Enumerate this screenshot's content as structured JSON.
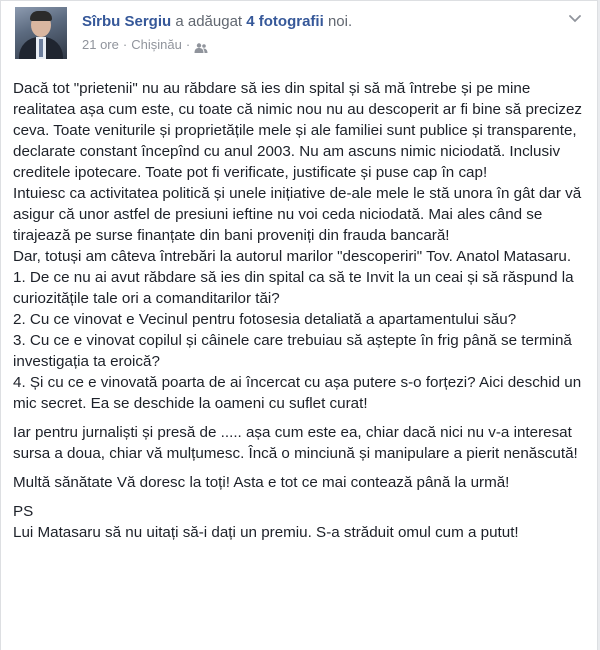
{
  "post": {
    "author": "Sîrbu Sergiu",
    "action_prefix": "a adăugat",
    "action_link": "4 fotografii",
    "action_suffix": "noi.",
    "time": "21 ore",
    "separator": "·",
    "location": "Chișinău",
    "audience_icon": "friends-icon",
    "menu_icon": "chevron-down-icon",
    "paragraphs": [
      "Dacă tot \"prietenii\" nu au răbdare să ies din spital și să mă întrebe și pe mine realitatea așa cum este, cu toate că nimic nou nu au descoperit ar fi bine să precizez ceva. Toate veniturile și proprietățile mele și ale familiei sunt publice și transparente, declarate constant începînd cu anul 2003. Nu am ascuns nimic niciodată. Inclusiv creditele ipotecare. Toate pot fi verificate, justificate și puse cap în cap!",
      "Intuiesc ca activitatea politică și unele inițiative de-ale mele le stă unora în gât dar vă asigur că unor astfel de presiuni ieftine nu voi ceda niciodată. Mai ales când se tirajează pe surse finanțate din bani proveniți din frauda bancară!",
      "Dar, totuși am câteva întrebări la autorul marilor \"descoperiri\" Tov. Anatol Matasaru.",
      "1. De ce nu ai avut răbdare să ies din spital ca să te Invit la un ceai și să răspund la curiozitățile tale ori a comanditarilor tăi?",
      "2. Cu ce vinovat e Vecinul pentru fotosesia detaliată a apartamentului său?",
      "3. Cu ce e vinovat copilul și câinele care trebuiau să aștepte în frig până se termină investigația ta eroică?",
      "4. Și cu ce e vinovată poarta de ai încercat cu așa putere s-o forțezi? Aici deschid un mic secret. Ea se deschide la oameni cu suflet curat!",
      "Iar pentru jurnaliști și presă de ..... așa cum este ea, chiar dacă nici nu v-a interesat sursa a doua, chiar vă mulțumesc. Încă o minciună și manipulare a pierit nenăscută!",
      "Multă sănătate Vă doresc la toți! Asta e tot ce mai contează până la urmă!",
      "PS",
      "Lui Matasaru să nu uitați să-i dați un premiu. S-a străduit omul cum a putut!"
    ]
  }
}
